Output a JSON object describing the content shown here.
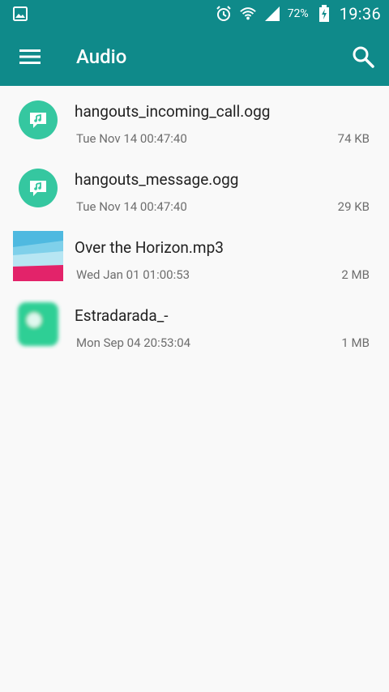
{
  "status_bar": {
    "time": "19:36",
    "battery_percent": "72%",
    "icons": [
      "image-icon",
      "alarm-icon",
      "wifi-icon",
      "signal-icon",
      "battery-charging-icon"
    ]
  },
  "app_bar": {
    "title": "Audio",
    "menu_icon": "hamburger-menu-icon",
    "search_icon": "search-icon"
  },
  "colors": {
    "primary": "#0f8a8a",
    "thumb_green": "#35c7a0",
    "background": "#f9f9f9"
  },
  "files": [
    {
      "name": "hangouts_incoming_call.ogg",
      "date": "Tue Nov 14 00:47:40",
      "size": "74 KB",
      "thumb": "hangouts-icon"
    },
    {
      "name": "hangouts_message.ogg",
      "date": "Tue Nov 14 00:47:40",
      "size": "29 KB",
      "thumb": "hangouts-icon"
    },
    {
      "name": "Over the Horizon.mp3",
      "date": "Wed Jan 01 01:00:53",
      "size": "2 MB",
      "thumb": "album-art"
    },
    {
      "name": "Estradarada_-",
      "date": "Mon Sep 04 20:53:04",
      "size": "1 MB",
      "thumb": "album-art-blurred"
    }
  ]
}
